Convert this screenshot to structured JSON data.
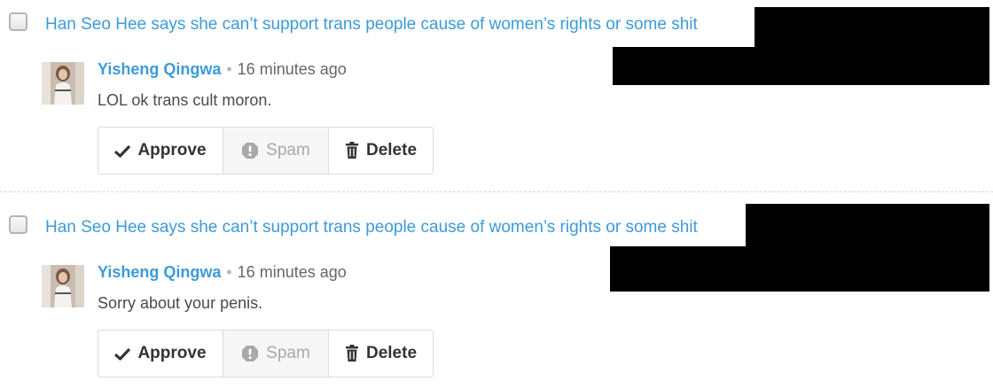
{
  "comments": [
    {
      "thread_title": "Han Seo Hee says she can’t support trans people cause of women’s rights or some shit",
      "author": "Yisheng Qingwa",
      "separator": "•",
      "time": "16 minutes ago",
      "text": "LOL ok trans cult moron.",
      "actions": {
        "approve": "Approve",
        "spam": "Spam",
        "delete": "Delete"
      }
    },
    {
      "thread_title": "Han Seo Hee says she can’t support trans people cause of women’s rights or some shit",
      "author": "Yisheng Qingwa",
      "separator": "•",
      "time": "16 minutes ago",
      "text": "Sorry about your penis.",
      "actions": {
        "approve": "Approve",
        "spam": "Spam",
        "delete": "Delete"
      }
    }
  ],
  "icons": {
    "approve": "checkmark-icon",
    "spam": "exclamation-octagon-icon",
    "delete": "trash-icon"
  },
  "colors": {
    "link": "#3d9ad9",
    "redaction": "#000000"
  }
}
